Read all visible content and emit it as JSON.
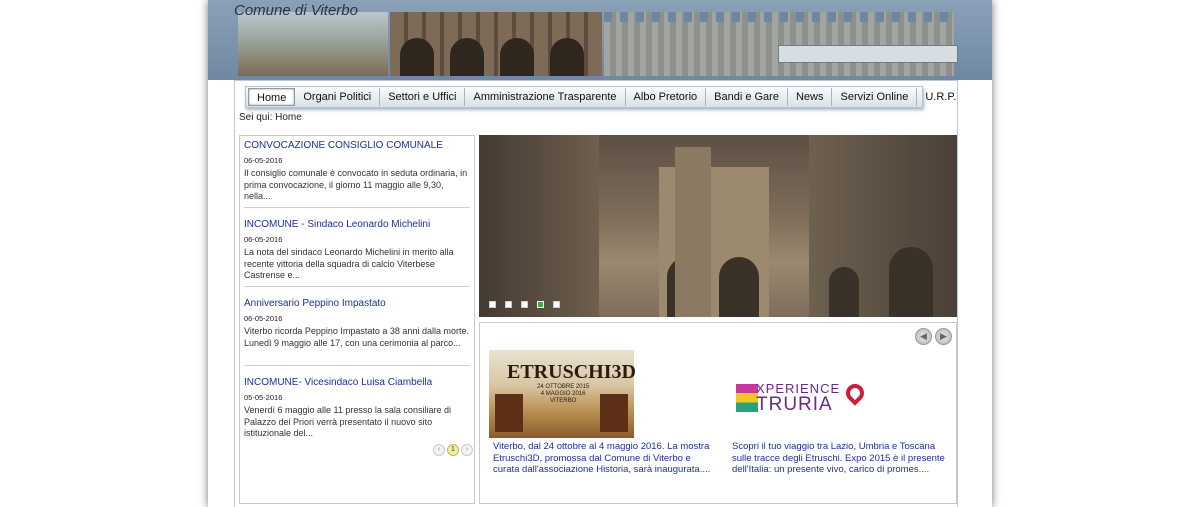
{
  "header": {
    "site_title": "Comune di Viterbo",
    "search_placeholder": ""
  },
  "nav": {
    "items": [
      "Home",
      "Organi Politici",
      "Settori e Uffici",
      "Amministrazione Trasparente",
      "Albo Pretorio",
      "Bandi e Gare",
      "News",
      "Servizi Online",
      "U.R.P."
    ],
    "active": "Home"
  },
  "breadcrumb": "Sei qui: Home",
  "news": [
    {
      "title": "CONVOCAZIONE CONSIGLIO COMUNALE",
      "date": "06-05-2016",
      "excerpt": "Il consiglio comunale è convocato in seduta ordinaria, in prima convocazione, il giorno 11 maggio alle 9,30, nella..."
    },
    {
      "title": "INCOMUNE - Sindaco Leonardo Michelini",
      "date": "06-05-2016",
      "excerpt": "La nota del sindaco Leonardo Michelini in merito alla recente vittoria della squadra di calcio Viterbese Castrense e..."
    },
    {
      "title": "Anniversario Peppino Impastato",
      "date": "06-05-2016",
      "excerpt": "Viterbo ricorda Peppino Impastato a 38 anni dalla morte. Lunedì 9 maggio alle 17, con una cerimonia al parco..."
    },
    {
      "title": "INCOMUNE- Vicesindaco Luisa Ciambella",
      "date": "05-05-2016",
      "excerpt": "  Venerdì 6 maggio alle 11 presso la sala consiliare di Palazzo dei Priori verrà presentato il nuovo sito istituzionale del..."
    }
  ],
  "news_pager": {
    "prev": "‹",
    "current": "1",
    "next": "›"
  },
  "slider": {
    "slide_count": 5,
    "active_index": 3
  },
  "featured": {
    "prev_icon": "arrow-left-icon",
    "next_icon": "arrow-right-icon",
    "cards": [
      {
        "image_title": "ETRUSCHI3D",
        "image_sub": "24 OTTOBRE 2015\n4 MAGGIO 2016\nVITERBO",
        "text": "Viterbo, dal 24 ottobre al 4 maggio 2016. La mostra Etruschi3D, promossa dal Comune di Viterbo e curata dall'associazione Historia, sarà inaugurata...."
      },
      {
        "logo_line1": "XPERIENCE",
        "logo_line2": "TRURIA",
        "text": "Scopri il tuo viaggio tra Lazio, Umbria e Toscana sulle tracce degli Etruschi. Expo 2015 è il presente dell'Italia: un presente vivo, carico di promes...."
      }
    ]
  }
}
